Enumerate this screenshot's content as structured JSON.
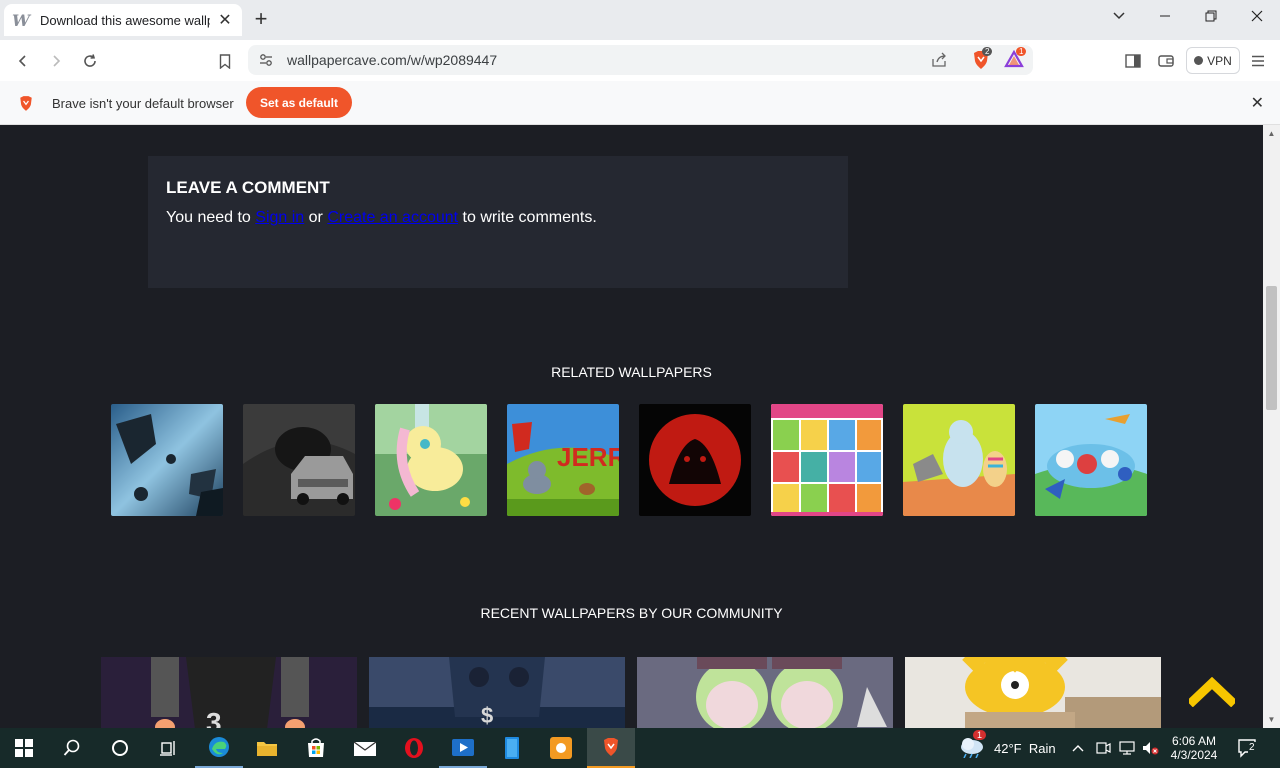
{
  "browser": {
    "tab_title": "Download this awesome wallpaper",
    "url": "wallpapercave.com/w/wp2089447",
    "vpn_label": "VPN",
    "brave_rewards_badge": "2",
    "brave_alert_badge": "1"
  },
  "infobar": {
    "message": "Brave isn't your default browser",
    "button_label": "Set as default"
  },
  "comment": {
    "heading": "LEAVE A COMMENT",
    "text_before": "You need to ",
    "signin_link": "Sign in",
    "text_middle": " or ",
    "create_link": "Create an account",
    "text_after": " to write comments."
  },
  "related": {
    "title": "RELATED WALLPAPERS"
  },
  "recent": {
    "title": "RECENT WALLPAPERS BY OUR COMMUNITY"
  },
  "taskbar": {
    "weather_badge": "1",
    "weather_text": "42°F  Rain",
    "time": "6:06 AM",
    "date": "4/3/2024",
    "notification_count": "2"
  },
  "colors": {
    "page_bg": "#1c1e24",
    "card_bg": "#252831",
    "accent_orange": "#f0552a",
    "scroll_top_yellow": "#f7c600",
    "taskbar_bg": "#172a29"
  }
}
